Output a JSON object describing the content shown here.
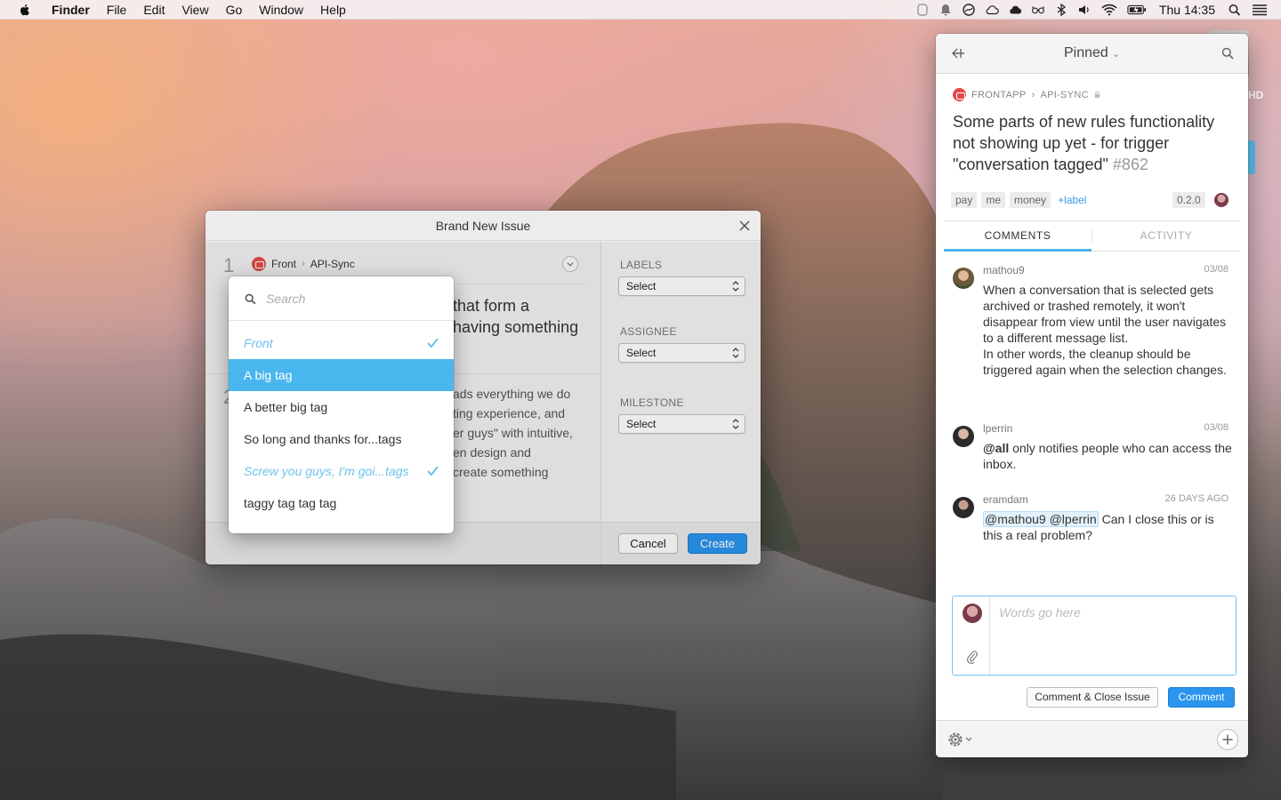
{
  "menubar": {
    "app_name": "Finder",
    "items": [
      "File",
      "Edit",
      "View",
      "Go",
      "Window",
      "Help"
    ],
    "clock": "Thu 14:35",
    "status_icons": [
      "notification-icon",
      "bell-icon",
      "do-not-disturb-icon",
      "cloud-icon",
      "cloud-filled-icon",
      "glasses-icon",
      "bluetooth-icon",
      "volume-icon",
      "wifi-icon",
      "battery-icon",
      "spotlight-icon",
      "list-icon"
    ]
  },
  "desktop": {
    "hd_label": "HD"
  },
  "dialog": {
    "title": "Brand New Issue",
    "step1": "1",
    "step2": "2",
    "repo_org": "Front",
    "repo_name": "API-Sync",
    "title_fragment": "that form a\nhaving something",
    "body_fragment": "ads everything we do\nting experience, and\ner guys\" with intuitive,\nen design and\ncreate something",
    "labels_heading": "LABELS",
    "assignee_heading": "ASSIGNEE",
    "milestone_heading": "MILESTONE",
    "labels_select": "Select",
    "assignee_select": "Select",
    "milestone_select": "Select",
    "cancel_label": "Cancel",
    "create_label": "Create"
  },
  "popover": {
    "search_placeholder": "Search",
    "items": [
      {
        "label": "Front",
        "kind": "group",
        "checked": true
      },
      {
        "label": "A big tag",
        "kind": "selected",
        "checked": false
      },
      {
        "label": "A better big tag",
        "kind": "normal",
        "checked": false
      },
      {
        "label": "So long and thanks for...tags",
        "kind": "normal",
        "checked": false
      },
      {
        "label": "Screw you guys, I'm goi...tags",
        "kind": "group",
        "checked": true
      },
      {
        "label": "taggy tag tag tag",
        "kind": "normal",
        "checked": false
      }
    ]
  },
  "panel": {
    "header_title": "Pinned",
    "repo_org": "FRONTAPP",
    "repo_name": "API-SYNC",
    "issue_title": "Some parts of new rules functionality not showing up yet - for trigger \"conversation tagged\"",
    "issue_number": "#862",
    "labels": [
      "pay",
      "me",
      "money"
    ],
    "add_label": "+label",
    "milestone": "0.2.0",
    "tabs": [
      "COMMENTS",
      "ACTIVITY"
    ],
    "comments": [
      {
        "author": "mathou9",
        "date": "03/08",
        "body": "When a conversation that is selected gets archived or trashed remotely, it won't disappear from view until the user navigates to a different message list.\nIn other words, the cleanup should be triggered again when the selection changes."
      },
      {
        "author": "lperrin",
        "date": "03/08",
        "mention": "@all",
        "body": " only notifies people who can access the inbox."
      },
      {
        "author": "eramdam",
        "date": "26 DAYS AGO",
        "mention": "@mathou9 @lperrin",
        "body": " Can I close this or is this a real problem?"
      }
    ],
    "composer_placeholder": "Words go here",
    "close_issue_label": "Comment & Close Issue",
    "comment_label": "Comment"
  },
  "colors": {
    "accent": "#2a94ee",
    "selection": "#4ab6ee",
    "group_text": "#6cc3f0"
  }
}
